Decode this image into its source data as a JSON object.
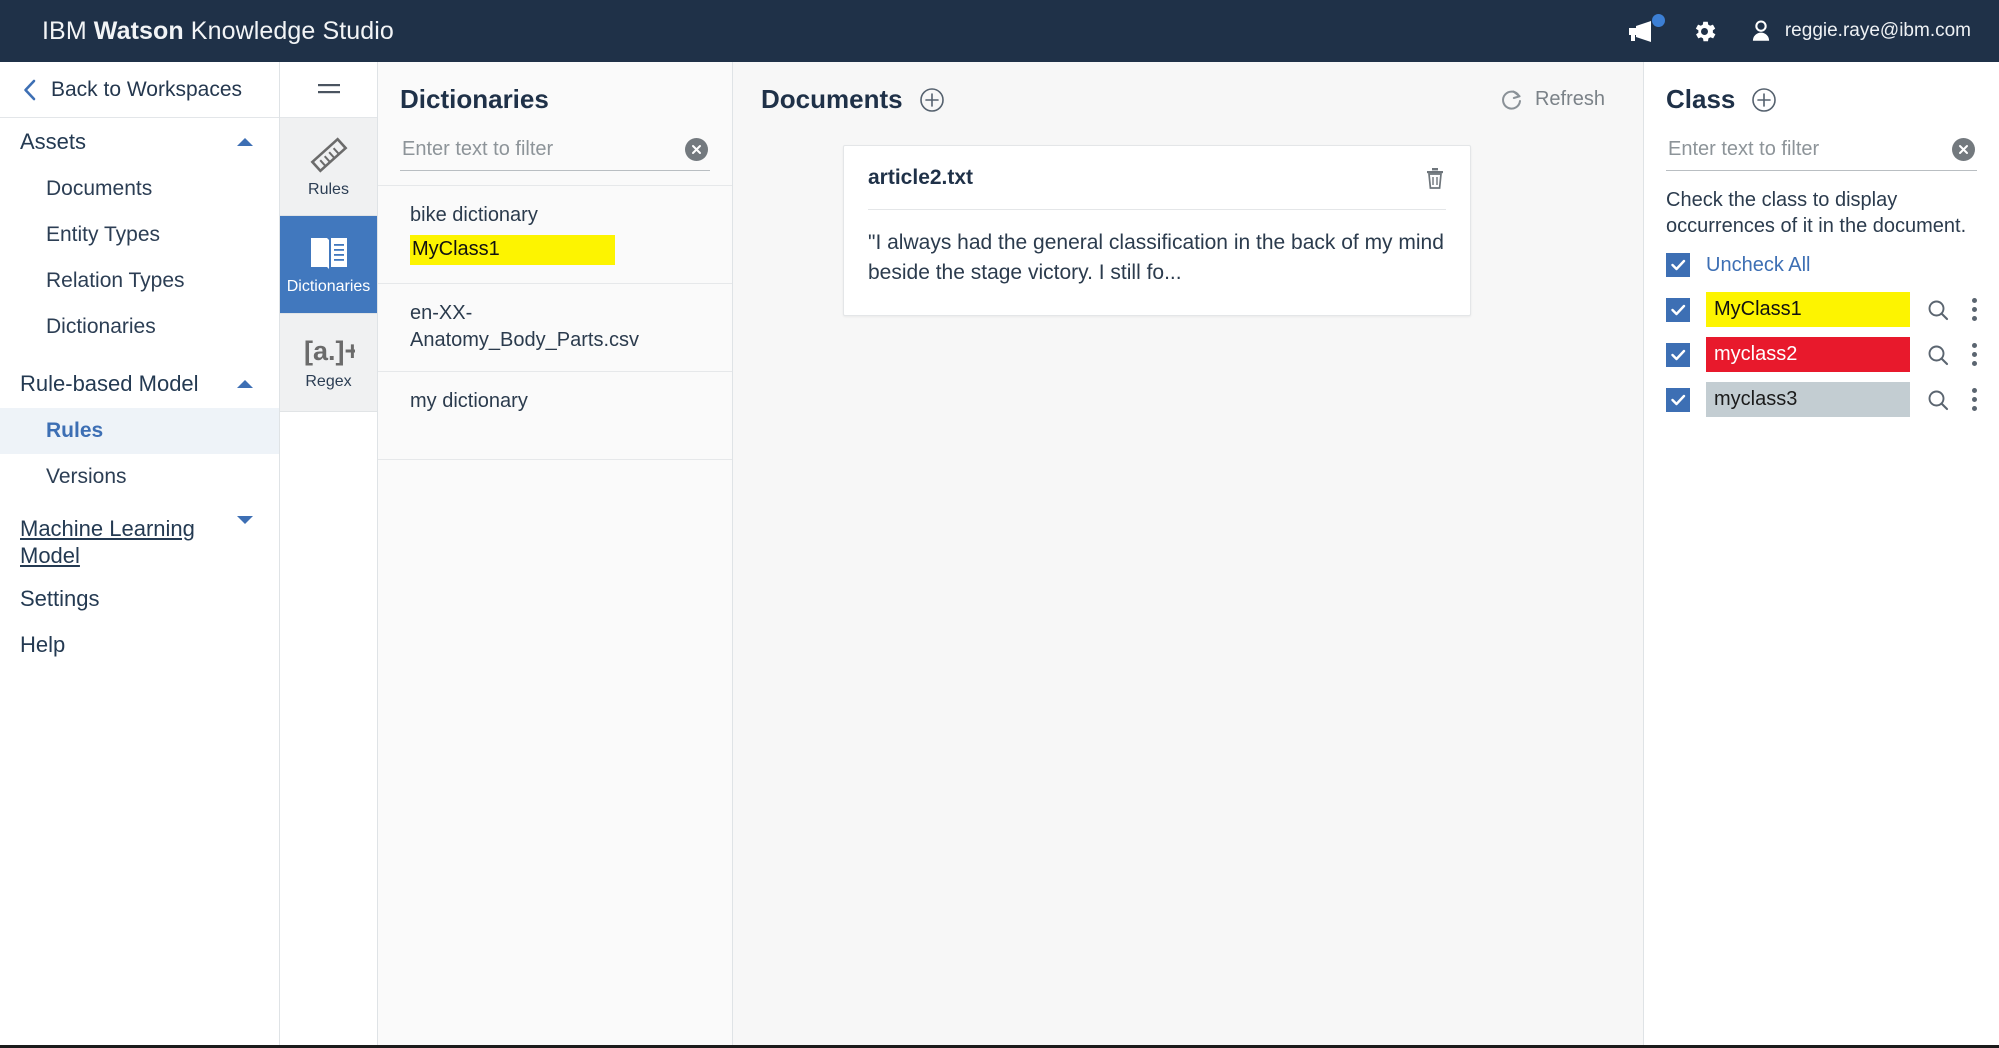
{
  "topbar": {
    "brand_prefix": "IBM ",
    "brand_bold": "Watson",
    "brand_suffix": " Knowledge Studio",
    "announcement_icon": "megaphone-icon",
    "settings_icon": "gear-icon",
    "user_icon": "user-avatar-icon",
    "user_email": "reggie.raye@ibm.com",
    "background": "#1f3148",
    "notification_dot_color": "#3c7fd4"
  },
  "sidebar": {
    "back_label": "Back to Workspaces",
    "back_icon": "chevron-left-icon",
    "groups": [
      {
        "label": "Assets",
        "expanded": true,
        "chevron": "chevron-up-icon",
        "items": [
          {
            "label": "Documents",
            "active": false
          },
          {
            "label": "Entity Types",
            "active": false
          },
          {
            "label": "Relation Types",
            "active": false
          },
          {
            "label": "Dictionaries",
            "active": false
          }
        ]
      },
      {
        "label": "Rule-based Model",
        "expanded": true,
        "chevron": "chevron-up-icon",
        "items": [
          {
            "label": "Rules",
            "active": true
          },
          {
            "label": "Versions",
            "active": false
          }
        ]
      }
    ],
    "ml_model_label": "Machine Learning Model",
    "ml_model_chevron": "chevron-down-icon",
    "settings_label": "Settings",
    "help_label": "Help",
    "active_color": "#3d6fb4",
    "active_bg": "#eef3f8"
  },
  "rail": {
    "hamburger_icon": "hamburger-menu-icon",
    "buttons": [
      {
        "label": "Rules",
        "icon": "ruler-icon",
        "active": false
      },
      {
        "label": "Dictionaries",
        "icon": "open-book-icon",
        "active": true
      },
      {
        "label": "Regex",
        "icon": "regex-bracket-icon",
        "active": false
      }
    ],
    "active_bg": "#4178be"
  },
  "dictionaries": {
    "title": "Dictionaries",
    "filter_placeholder": "Enter text to filter",
    "filter_value": "",
    "clear_icon": "clear-circle-icon",
    "items": [
      {
        "name": "bike dictionary",
        "badge": "MyClass1",
        "badge_bg": "#fdf400",
        "badge_fg": "#111111"
      },
      {
        "name": "en-XX-Anatomy_Body_Parts.csv",
        "badge": "",
        "badge_bg": "",
        "badge_fg": ""
      },
      {
        "name": "my dictionary",
        "badge": "",
        "badge_bg": "",
        "badge_fg": ""
      }
    ]
  },
  "documents": {
    "title": "Documents",
    "add_icon": "plus-circle-icon",
    "refresh_label": "Refresh",
    "refresh_icon": "refresh-icon",
    "card": {
      "name": "article2.txt",
      "delete_icon": "trash-icon",
      "preview": "\"I always had the general classification in the back of my mind beside the stage victory. I still fo..."
    }
  },
  "classes": {
    "title": "Class",
    "add_icon": "plus-circle-icon",
    "filter_placeholder": "Enter text to filter",
    "filter_value": "",
    "clear_icon": "clear-circle-icon",
    "hint": "Check the class to display occurrences of it in the document.",
    "uncheck_all_label": "Uncheck All",
    "uncheck_all_checked": true,
    "search_icon": "magnifier-icon",
    "menu_icon": "kebab-menu-icon",
    "items": [
      {
        "label": "MyClass1",
        "checked": true,
        "bg": "#fdf400",
        "fg": "#111111"
      },
      {
        "label": "myclass2",
        "checked": true,
        "bg": "#e8192c",
        "fg": "#ffffff"
      },
      {
        "label": "myclass3",
        "checked": true,
        "bg": "#c3cdd2",
        "fg": "#1b1b1b"
      }
    ],
    "checkbox_color": "#3d6fb4"
  }
}
